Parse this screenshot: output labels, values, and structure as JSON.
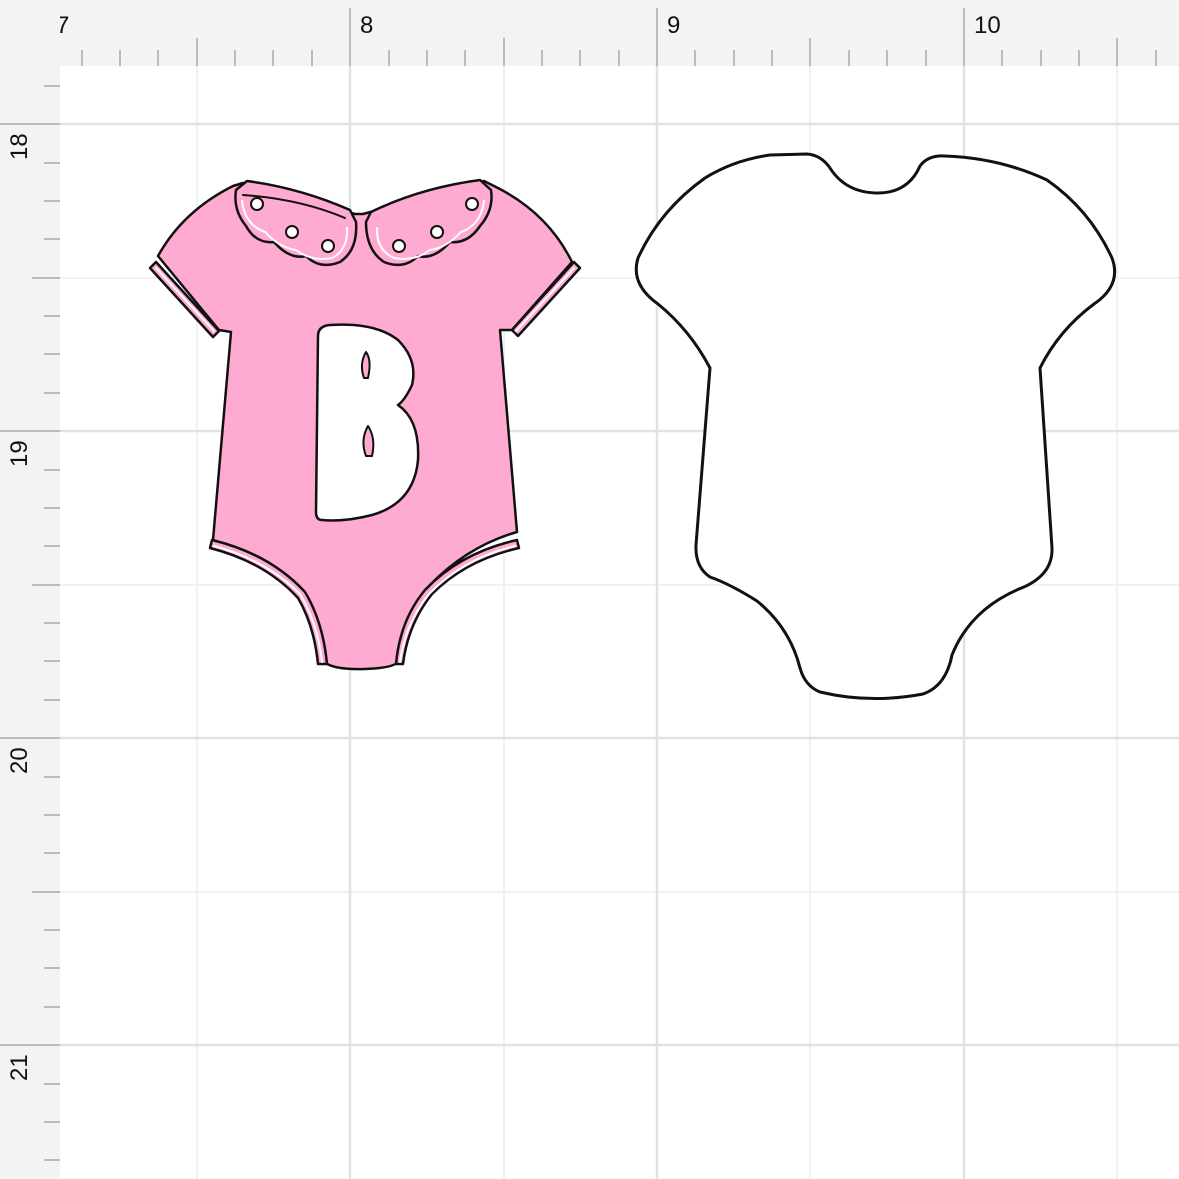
{
  "ruler": {
    "top_labels": [
      "7",
      "8",
      "9",
      "10"
    ],
    "left_labels": [
      "18",
      "19",
      "20",
      "21"
    ]
  },
  "colors": {
    "background": "#ffffff",
    "ruler_bg": "#f3f3f3",
    "major_grid": "#e2e2e2",
    "minor_grid": "#f1f1f1",
    "tick": "#bbbbbb",
    "onesie_fill": "#ffaad0",
    "outline": "#111111",
    "letter_fill": "#ffffff"
  },
  "canvas": {
    "onesie_decorated": {
      "letter": "B",
      "fill_color": "pink"
    },
    "onesie_blank": {
      "fill_color": "white"
    }
  }
}
